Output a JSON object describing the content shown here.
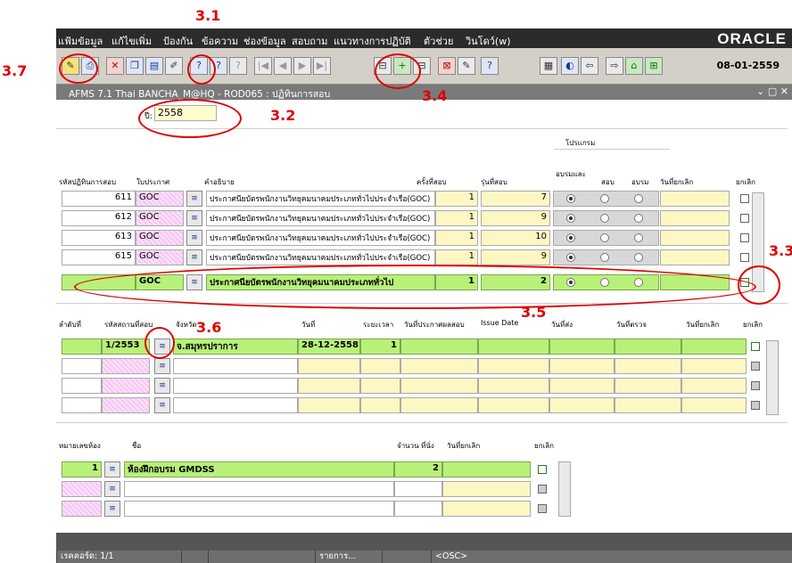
{
  "menu": [
    "แฟ้มข้อมูล",
    "แก้ไขเพิ่ม",
    "ป้องกัน",
    "ข้อความ",
    "ช่องข้อมูล",
    "สอบถาม",
    "แนวทางการปฏิบัติ",
    "ตัวช่วย",
    "วินโดว์(w)"
  ],
  "brand": "ORACLE",
  "toolbar_date": "08-01-2559",
  "window_title": "AFMS 7.1 Thai BANCHA_M@HQ - ROD065 : ปฏิทินการสอบ",
  "year_label": "ปี:",
  "year_value": "2558",
  "section_program_label": "โปรแกรม",
  "grid1": {
    "headers": {
      "code": "รหัสปฏิทินการสอบ",
      "notice": "ใบประกาศ",
      "desc": "คำอธิบาย",
      "times": "ครั้งที่สอบ",
      "batch": "รุ่นที่สอบ",
      "train_exam": "อบรมและ",
      "exam": "สอบ",
      "train": "อบรม",
      "cancel_date": "วันที่ยกเลิก",
      "cancel": "ยกเลิก"
    },
    "rows": [
      {
        "code": "611",
        "notice": "GOC",
        "desc": "ประกาศนียบัตรพนักงานวิทยุคมนาคมประเภททั่วไปประจำเรือ(GOC)",
        "times": "1",
        "batch": "7"
      },
      {
        "code": "612",
        "notice": "GOC",
        "desc": "ประกาศนียบัตรพนักงานวิทยุคมนาคมประเภททั่วไปประจำเรือ(GOC)",
        "times": "1",
        "batch": "9"
      },
      {
        "code": "613",
        "notice": "GOC",
        "desc": "ประกาศนียบัตรพนักงานวิทยุคมนาคมประเภททั่วไปประจำเรือ(GOC)",
        "times": "1",
        "batch": "10"
      },
      {
        "code": "615",
        "notice": "GOC",
        "desc": "ประกาศนียบัตรพนักงานวิทยุคมนาคมประเภททั่วไปประจำเรือ(GOC)",
        "times": "1",
        "batch": "9"
      },
      {
        "code": "",
        "notice": "GOC",
        "desc": "ประกาศนียบัตรพนักงานวิทยุคมนาคมประเภททั่วไป",
        "times": "1",
        "batch": "2"
      }
    ]
  },
  "grid2": {
    "headers": {
      "seq": "ลำดับที่",
      "loc_code": "รหัสสถานที่สอบ",
      "province": "จังหวัด",
      "date": "วันที่",
      "duration": "ระยะเวลา",
      "announce": "วันที่ประกาศผลสอบ",
      "issue": "Issue Date",
      "sent": "วันที่ส่ง",
      "check": "วันที่ตรวจ",
      "cancel_date": "วันที่ยกเลิก",
      "cancel": "ยกเลิก"
    },
    "row": {
      "loc_code": "1/2553",
      "province": "จ.สมุทรปราการ",
      "date": "28-12-2558",
      "duration": "1"
    }
  },
  "grid3": {
    "headers": {
      "room": "หมายเลขห้อง",
      "name": "ชื่อ",
      "seats": "จำนวน ที่นั่ง",
      "cancel_date": "วันที่ยกเลิก",
      "cancel": "ยกเลิก"
    },
    "row": {
      "room": "1",
      "name": "ห้องฝึกอบรม GMDSS",
      "seats": "2"
    }
  },
  "status": {
    "record": "เรคคอร์ด: 1/1",
    "list": "รายการ...",
    "osc": "<OSC>"
  },
  "annotations": [
    "3.1",
    "3.2",
    "3.3",
    "3.4",
    "3.5",
    "3.6",
    "3.7"
  ]
}
